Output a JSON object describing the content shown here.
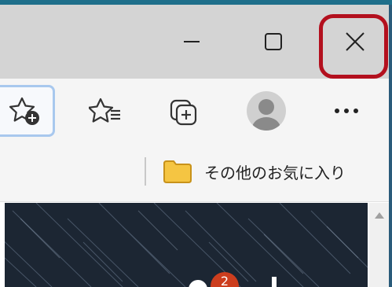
{
  "titlebar": {
    "minimize_icon": "minimize-icon",
    "maximize_icon": "maximize-icon",
    "close_icon": "close-icon",
    "highlight_color": "#b3101e"
  },
  "toolbar": {
    "buttons": [
      {
        "icon": "star-add-icon"
      },
      {
        "icon": "favorites-list-icon"
      },
      {
        "icon": "collections-icon"
      },
      {
        "icon": "profile-avatar-icon"
      },
      {
        "icon": "more-options-icon",
        "label": "···"
      }
    ]
  },
  "bookmarks": {
    "folder_label": "その他のお気に入り",
    "folder_icon": "folder-icon",
    "folder_color": "#f5c542"
  },
  "content": {
    "notification_count": "2"
  },
  "colors": {
    "accent": "#1f6f8b",
    "titlebar_bg": "#d4d4d4",
    "toolbar_bg": "#f5f5f5",
    "content_bg": "#1c2633"
  }
}
